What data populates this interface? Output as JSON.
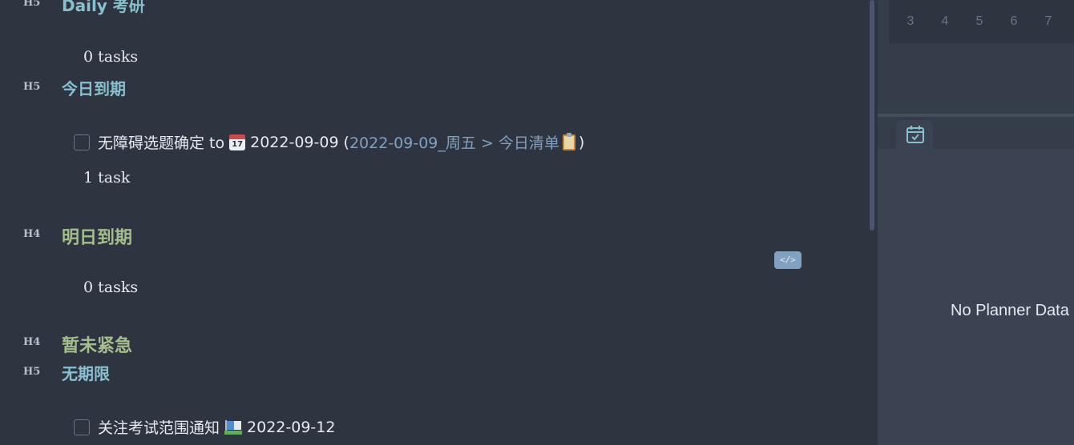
{
  "editor": {
    "sections": [
      {
        "level": "H5",
        "title": "Daily 考研",
        "count": "0 tasks"
      },
      {
        "level": "H5",
        "title": "今日到期",
        "count": "1 task"
      },
      {
        "level": "H4",
        "title": "明日到期",
        "count": "0 tasks"
      },
      {
        "level": "H4",
        "title": "暂未紧急"
      },
      {
        "level": "H5",
        "title": "无期限"
      }
    ],
    "task_today": {
      "text": "无障碍选题确定 to",
      "date_icon_num": "17",
      "date": "2022-09-09",
      "open_paren": "(",
      "link": "2022-09-09_周五 > 今日清单",
      "close_paren": ")"
    },
    "task_nodate": {
      "text": "关注考试范围通知",
      "date": "2022-09-12"
    },
    "code_badge": "</>",
    "colors": {
      "h5": "#88c0d0",
      "h4": "#a3be8c",
      "link": "#81a1c1",
      "background": "#2e3440"
    }
  },
  "right_panel": {
    "calendar_days": [
      "3",
      "4",
      "5",
      "6",
      "7"
    ],
    "tab_icon": "calendar-check-icon",
    "empty_message": "No Planner Data"
  }
}
